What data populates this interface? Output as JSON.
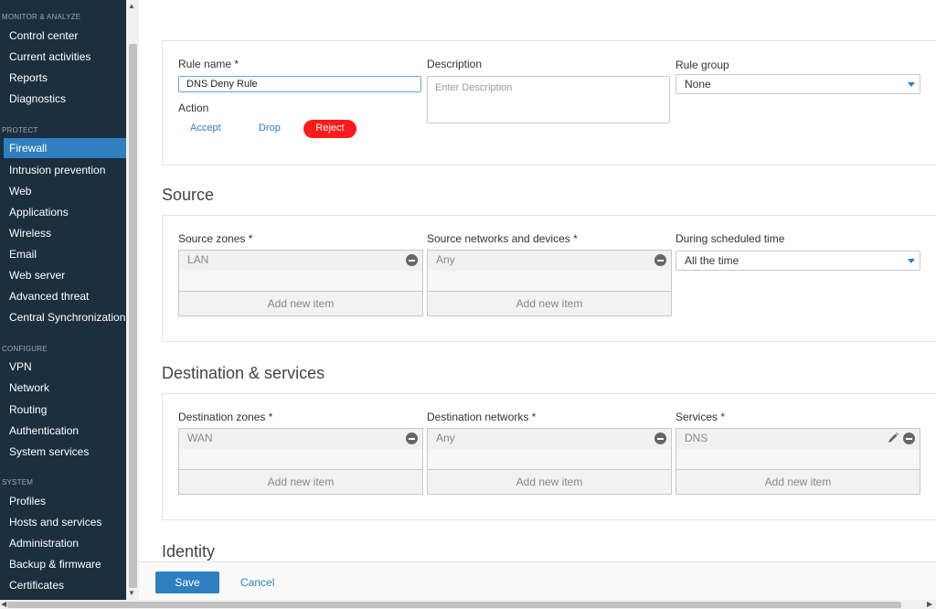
{
  "sidebar": {
    "sections": [
      {
        "title": "MONITOR & ANALYZE",
        "items": [
          "Control center",
          "Current activities",
          "Reports",
          "Diagnostics"
        ]
      },
      {
        "title": "PROTECT",
        "items": [
          "Firewall",
          "Intrusion prevention",
          "Web",
          "Applications",
          "Wireless",
          "Email",
          "Web server",
          "Advanced threat",
          "Central Synchronization"
        ]
      },
      {
        "title": "CONFIGURE",
        "items": [
          "VPN",
          "Network",
          "Routing",
          "Authentication",
          "System services"
        ]
      },
      {
        "title": "SYSTEM",
        "items": [
          "Profiles",
          "Hosts and services",
          "Administration",
          "Backup & firmware",
          "Certificates"
        ]
      }
    ],
    "active_item": "Firewall"
  },
  "rule": {
    "name_label": "Rule name *",
    "name_value": "DNS Deny Rule",
    "description_label": "Description",
    "description_placeholder": "Enter Description",
    "group_label": "Rule group",
    "group_value": "None",
    "action_label": "Action",
    "actions": [
      "Accept",
      "Drop",
      "Reject"
    ],
    "selected_action": "Reject"
  },
  "source": {
    "title": "Source",
    "zones_label": "Source zones *",
    "zones_item": "LAN",
    "networks_label": "Source networks and devices *",
    "networks_item": "Any",
    "schedule_label": "During scheduled time",
    "schedule_value": "All the time",
    "add_label": "Add new item"
  },
  "destination": {
    "title": "Destination & services",
    "zones_label": "Destination zones *",
    "zones_item": "WAN",
    "networks_label": "Destination networks *",
    "networks_item": "Any",
    "services_label": "Services *",
    "services_item": "DNS",
    "add_label": "Add new item"
  },
  "identity": {
    "title": "Identity"
  },
  "footer": {
    "save_label": "Save",
    "cancel_label": "Cancel"
  },
  "colors": {
    "accent": "#2f7fc1",
    "sidebar_bg": "#1c2f3f",
    "reject": "#ff1a1a"
  }
}
